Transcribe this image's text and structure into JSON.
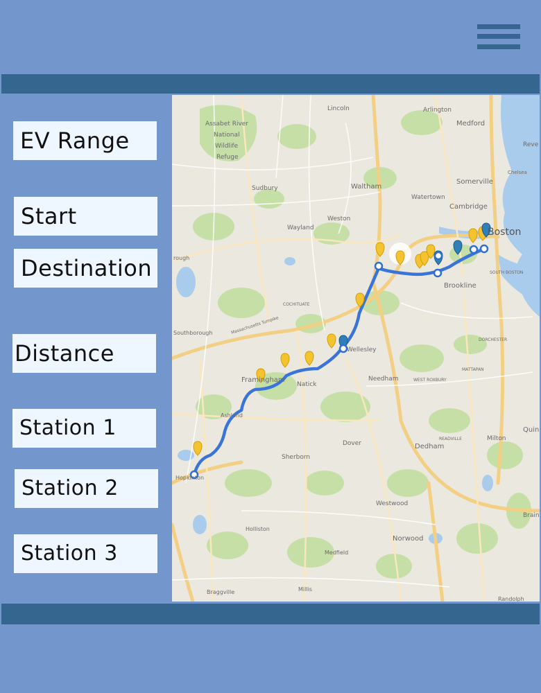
{
  "menu_icon": "hamburger-menu-icon",
  "sidebar": {
    "fields": [
      {
        "key": "ev_range",
        "label": "EV Range"
      },
      {
        "key": "start",
        "label": "Start"
      },
      {
        "key": "destination",
        "label": "Destination"
      },
      {
        "key": "distance",
        "label": "Distance"
      },
      {
        "key": "station_1",
        "label": "Station 1"
      },
      {
        "key": "station_2",
        "label": "Station 2"
      },
      {
        "key": "station_3",
        "label": "Station 3"
      }
    ]
  },
  "map": {
    "route_color": "#3a74d9",
    "labels": {
      "lincoln": "Lincoln",
      "arlington": "Arlington",
      "medford": "Medford",
      "assabet_1": "Assabet River",
      "assabet_2": "National",
      "assabet_3": "Wildlife",
      "assabet_4": "Refuge",
      "sudbury": "Sudbury",
      "waltham": "Waltham",
      "watertown": "Watertown",
      "somerville": "Somerville",
      "cambridge": "Cambridge",
      "boston": "Boston",
      "wayland": "Wayland",
      "weston": "Weston",
      "brookline": "Brookline",
      "south_boston": "SOUTH BOSTON",
      "cochituate": "COCHITUATE",
      "southborough": "Southborough",
      "framingham": "Framingham",
      "natick": "Natick",
      "wellesley": "Wellesley",
      "needham": "Needham",
      "west_roxbury": "WEST ROXBURY",
      "mattapan": "MATTAPAN",
      "dorchester": "DORCHESTER",
      "ashland": "Ashland",
      "hopkinton": "Hopkinton",
      "sherborn": "Sherborn",
      "dover": "Dover",
      "dedham": "Dedham",
      "readville": "READVILLE",
      "milton": "Milton",
      "quincy": "Quin",
      "braintree": "Braint",
      "westwood": "Westwood",
      "holliston": "Holliston",
      "norwood": "Norwood",
      "medfield": "Medfield",
      "braggville": "Braggville",
      "millis": "Millis",
      "randolph": "Randolph",
      "revere": "Reve",
      "chelsea": "Chelsea",
      "rough": "rough",
      "mass_pike": "Massachusetts Turnpike"
    }
  }
}
